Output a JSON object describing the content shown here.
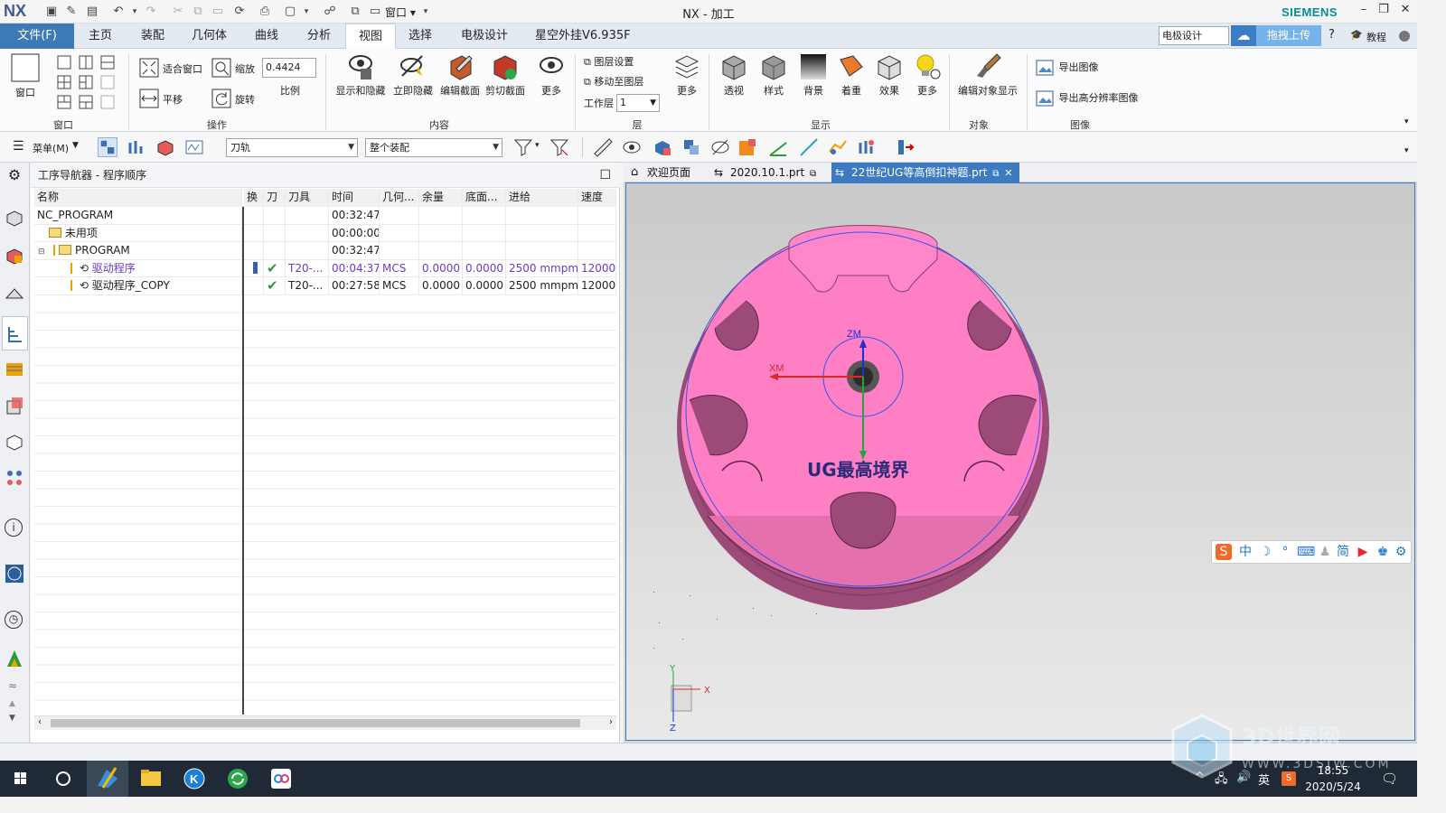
{
  "app": {
    "logo": "NX",
    "title": "NX - 加工",
    "brand": "SIEMENS"
  },
  "menubar": {
    "file_label": "文件(F)",
    "tabs": [
      "主页",
      "装配",
      "几何体",
      "曲线",
      "分析",
      "视图",
      "选择",
      "电极设计",
      "星空外挂V6.935F"
    ],
    "active_tab": "视图",
    "search_value": "电极设计",
    "upload_label": "拖拽上传",
    "tutorial_label": "教程"
  },
  "ribbon": {
    "window_group": {
      "window_label": "窗口",
      "group_label": "窗口"
    },
    "ops_group": {
      "fit_label": "适合窗口",
      "zoom_label": "缩放",
      "zoom_value": "0.4424",
      "pan_label": "平移",
      "ratio_label": "比例",
      "rotate_label": "旋转",
      "group_label": "操作"
    },
    "content_group": {
      "items": [
        "显示和隐藏",
        "立即隐藏",
        "编辑截面",
        "剪切截面",
        "更多"
      ],
      "group_label": "内容"
    },
    "layer_group": {
      "layer_settings": "图层设置",
      "move_to_layer": "移动至图层",
      "work_layer_label": "工作层",
      "work_layer_value": "1",
      "more": "更多",
      "group_label": "层"
    },
    "display_group": {
      "items": [
        "透视",
        "样式",
        "背景",
        "着重",
        "效果",
        "更多"
      ],
      "group_label": "显示"
    },
    "object_group": {
      "item": "编辑对象显示",
      "group_label": "对象"
    },
    "image_group": {
      "export_image": "导出图像",
      "export_hires": "导出高分辨率图像",
      "group_label": "图像"
    }
  },
  "toolbar2": {
    "menu_label": "菜单(M)",
    "filter_value": "刀轨",
    "scope_value": "整个装配"
  },
  "navigator": {
    "title": "工序导航器 - 程序顺序",
    "columns": [
      "名称",
      "换",
      "刀",
      "刀具",
      "时间",
      "几何...",
      "余量",
      "底面...",
      "进给",
      "速度"
    ],
    "rows": [
      {
        "name": "NC_PROGRAM",
        "time": "00:32:47"
      },
      {
        "name": "未用项",
        "time": "00:00:00"
      },
      {
        "name": "PROGRAM",
        "time": "00:32:47"
      },
      {
        "name": "驱动程序",
        "tool": "T20-...",
        "time": "00:04:37",
        "geom": "MCS",
        "stock": "0.0000",
        "floor": "0.0000",
        "feed": "2500 mmpm",
        "speed": "12000"
      },
      {
        "name": "驱动程序_COPY",
        "tool": "T20-...",
        "time": "00:27:58",
        "geom": "MCS",
        "stock": "0.0000",
        "floor": "0.0000",
        "feed": "2500 mmpm",
        "speed": "12000"
      }
    ]
  },
  "viewport": {
    "tabs": [
      "欢迎页面",
      "2020.10.1.prt",
      "22世纪UG等高倒扣神题.prt"
    ],
    "active_tab_index": 2,
    "watermark_text": "UG最高境界",
    "axis_labels": {
      "zm": "ZM",
      "xm": "XM",
      "y": "Y",
      "x": "X",
      "z": "Z"
    },
    "part_color": "#ff7fc4"
  },
  "ime": {
    "items": [
      "中",
      "简"
    ]
  },
  "taskbar": {
    "time": "18:55",
    "date": "2020/5/24",
    "lang": "英"
  },
  "site_watermark": {
    "title": "3D世界网",
    "url": "WWW.3DSJW.COM"
  },
  "colors": {
    "accent": "#3e7ab8",
    "brand": "#0a8c94",
    "check": "#2a9d3a"
  }
}
